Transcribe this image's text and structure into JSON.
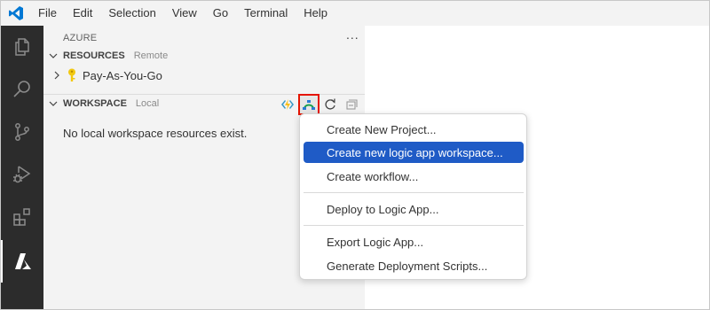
{
  "menu": [
    "File",
    "Edit",
    "Selection",
    "View",
    "Go",
    "Terminal",
    "Help"
  ],
  "activity_icons": [
    "explorer-icon",
    "search-icon",
    "source-control-icon",
    "run-debug-icon",
    "extensions-icon",
    "azure-icon"
  ],
  "sidebar": {
    "title": "AZURE",
    "more": "...",
    "resources": {
      "name": "RESOURCES",
      "desc": "Remote",
      "items": [
        {
          "label": "Pay-As-You-Go",
          "icon": "key-icon"
        }
      ]
    },
    "workspace": {
      "name": "WORKSPACE",
      "desc": "Local",
      "empty_message": "No local workspace resources exist.",
      "actions": [
        "functions-icon",
        "logic-app-workspace-icon",
        "refresh-icon",
        "collapse-all-icon"
      ]
    }
  },
  "context_menu": {
    "items": [
      "Create New Project...",
      "Create new logic app workspace...",
      "Create workflow...",
      "Deploy to Logic App...",
      "Export Logic App...",
      "Generate Deployment Scripts..."
    ],
    "selected_index": 1
  },
  "colors": {
    "activity_bar": "#2c2c2c",
    "sidebar": "#f3f3f3",
    "selection": "#1f5bc6",
    "highlight_border": "#e51400",
    "vscode_blue": "#0078d4"
  }
}
